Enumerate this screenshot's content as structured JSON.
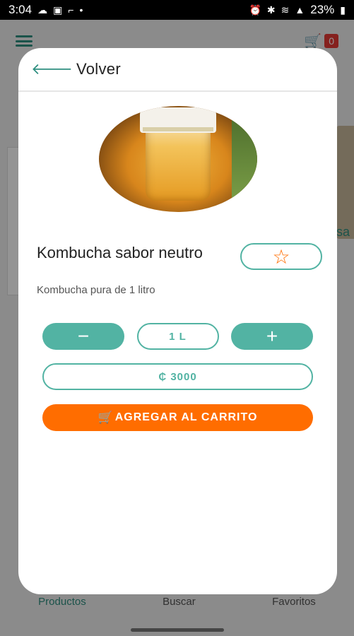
{
  "status_bar": {
    "time": "3:04",
    "battery": "23%"
  },
  "header": {
    "cart_count": "0"
  },
  "background": {
    "partial_label": "sa"
  },
  "bottom_nav": [
    {
      "label": "Productos"
    },
    {
      "label": "Buscar"
    },
    {
      "label": "Favoritos"
    }
  ],
  "modal": {
    "back_label": "Volver",
    "product": {
      "title": "Kombucha sabor neutro",
      "subtitle": "Kombucha pura de 1 litro",
      "quantity": "1 L",
      "price": "₵ 3000"
    },
    "minus_label": "−",
    "plus_label": "+",
    "add_to_cart_label": "AGREGAR AL CARRITO"
  },
  "colors": {
    "accent": "#52b3a3",
    "primary_dark": "#2f8f80",
    "cta": "#ff6d00"
  },
  "icons": [
    "back-arrow-icon",
    "star-icon",
    "cart-icon",
    "home-icon",
    "search-icon",
    "menu-icon"
  ]
}
